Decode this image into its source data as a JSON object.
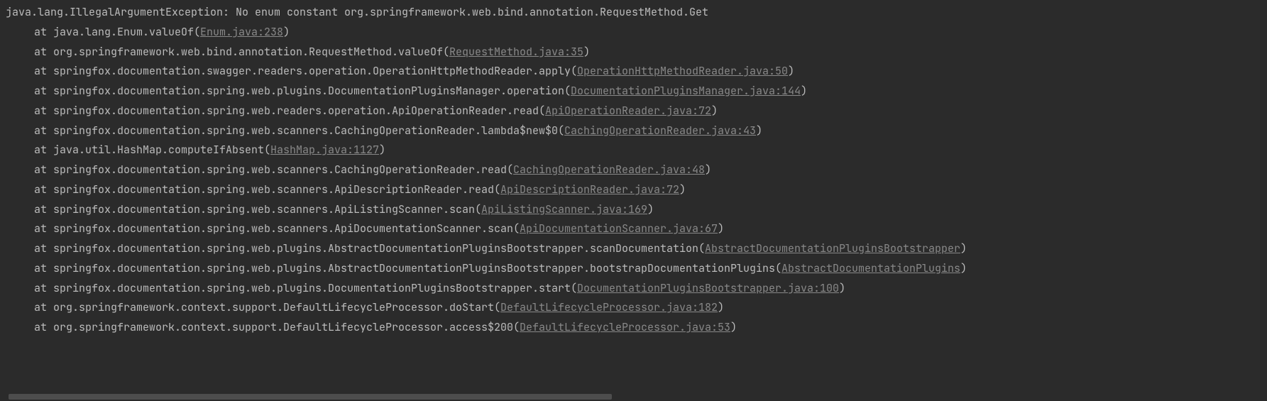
{
  "exception": "java.lang.IllegalArgumentException: No enum constant org.springframework.web.bind.annotation.RequestMethod.Get",
  "at": "at",
  "frames": [
    {
      "method": "java.lang.Enum.valueOf",
      "source": "Enum.java:238"
    },
    {
      "method": "org.springframework.web.bind.annotation.RequestMethod.valueOf",
      "source": "RequestMethod.java:35"
    },
    {
      "method": "springfox.documentation.swagger.readers.operation.OperationHttpMethodReader.apply",
      "source": "OperationHttpMethodReader.java:50"
    },
    {
      "method": "springfox.documentation.spring.web.plugins.DocumentationPluginsManager.operation",
      "source": "DocumentationPluginsManager.java:144"
    },
    {
      "method": "springfox.documentation.spring.web.readers.operation.ApiOperationReader.read",
      "source": "ApiOperationReader.java:72"
    },
    {
      "method": "springfox.documentation.spring.web.scanners.CachingOperationReader.lambda$new$0",
      "source": "CachingOperationReader.java:43"
    },
    {
      "method": "java.util.HashMap.computeIfAbsent",
      "source": "HashMap.java:1127"
    },
    {
      "method": "springfox.documentation.spring.web.scanners.CachingOperationReader.read",
      "source": "CachingOperationReader.java:48"
    },
    {
      "method": "springfox.documentation.spring.web.scanners.ApiDescriptionReader.read",
      "source": "ApiDescriptionReader.java:72"
    },
    {
      "method": "springfox.documentation.spring.web.scanners.ApiListingScanner.scan",
      "source": "ApiListingScanner.java:169"
    },
    {
      "method": "springfox.documentation.spring.web.scanners.ApiDocumentationScanner.scan",
      "source": "ApiDocumentationScanner.java:67"
    },
    {
      "method": "springfox.documentation.spring.web.plugins.AbstractDocumentationPluginsBootstrapper.scanDocumentation",
      "source": "AbstractDocumentationPluginsBootstrapper"
    },
    {
      "method": "springfox.documentation.spring.web.plugins.AbstractDocumentationPluginsBootstrapper.bootstrapDocumentationPlugins",
      "source": "AbstractDocumentationPlugins"
    },
    {
      "method": "springfox.documentation.spring.web.plugins.DocumentationPluginsBootstrapper.start",
      "source": "DocumentationPluginsBootstrapper.java:100"
    },
    {
      "method": "org.springframework.context.support.DefaultLifecycleProcessor.doStart",
      "source": "DefaultLifecycleProcessor.java:182"
    },
    {
      "method": "org.springframework.context.support.DefaultLifecycleProcessor.access$200",
      "source": "DefaultLifecycleProcessor.java:53"
    }
  ]
}
